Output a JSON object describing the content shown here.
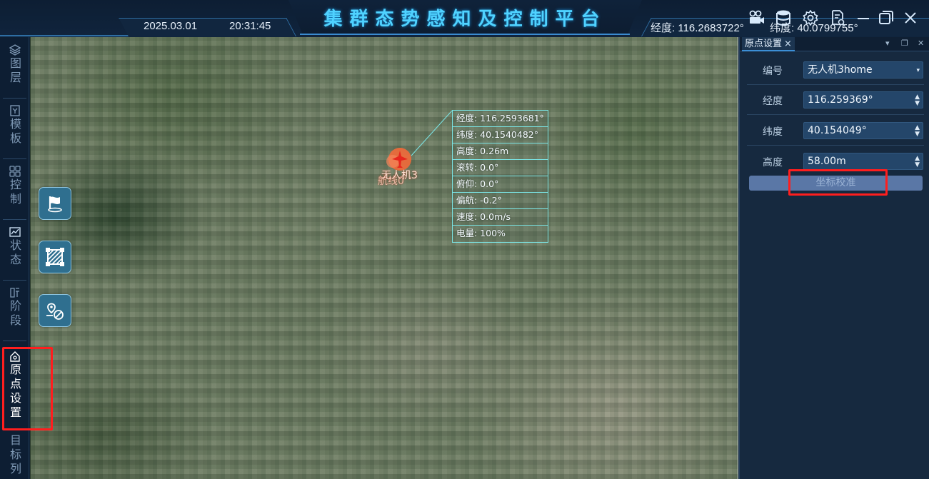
{
  "header": {
    "title": "集群态势感知及控制平台",
    "date": "2025.03.01",
    "time": "20:31:45",
    "longitude": "经度: 116.2683722°",
    "latitude": "纬度: 40.0799755°",
    "icons": [
      "video-camera-icon",
      "database-icon",
      "gear-icon",
      "report-icon",
      "minimize-icon",
      "restore-icon",
      "close-icon"
    ]
  },
  "left_nav": {
    "items": [
      {
        "label": "图层",
        "icon": "layers-icon"
      },
      {
        "label": "模板",
        "icon": "template-icon"
      },
      {
        "label": "控制",
        "icon": "control-grid-icon"
      },
      {
        "label": "状态",
        "icon": "status-chart-icon"
      },
      {
        "label": "阶段",
        "icon": "stage-icon"
      },
      {
        "label": "原点设置",
        "icon": "home-origin-icon",
        "active": true
      },
      {
        "label": "目标列",
        "icon": "target-list-icon"
      }
    ]
  },
  "map": {
    "tools": [
      "flag-icon",
      "area-hatch-icon",
      "no-location-icon"
    ],
    "drone": {
      "name": "无人机3",
      "route": "航线0",
      "marker_color": "#f26a3a"
    },
    "info_panel": {
      "rows": [
        "经度: 116.2593681°",
        "纬度: 40.1540482°",
        "高度: 0.26m",
        "滚转: 0.0°",
        "俯仰: 0.0°",
        "偏航: -0.2°",
        "速度: 0.0m/s",
        "电量: 100%"
      ]
    }
  },
  "right_panel": {
    "tab_title": "原点设置",
    "fields": [
      {
        "label": "编号",
        "value": "无人机3home",
        "control": "dropdown"
      },
      {
        "label": "经度",
        "value": "116.259369°",
        "control": "spinner"
      },
      {
        "label": "纬度",
        "value": "40.154049°",
        "control": "spinner"
      },
      {
        "label": "高度",
        "value": "58.00m",
        "control": "spinner"
      }
    ],
    "calibrate_button": "坐标校准"
  },
  "colors": {
    "title": "#4fd2ff",
    "highlight": "#ff1e1e",
    "info_border": "#7be6e6",
    "button": "#5a77a6"
  }
}
